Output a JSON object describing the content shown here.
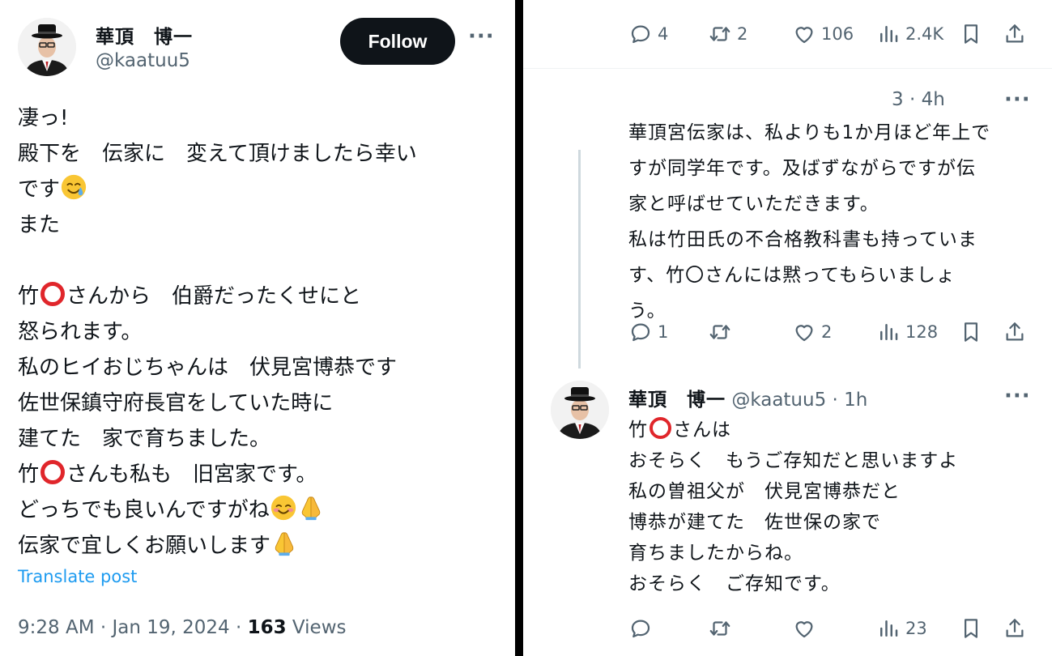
{
  "left": {
    "author_name": "華頂　博一",
    "author_handle": "@kaatuu5",
    "follow_label": "Follow",
    "more_label": "···",
    "body": {
      "l1": "凄っ!",
      "l2": "殿下を　伝家に　変えて頂けましたら幸い",
      "l3": "です",
      "l4": "また",
      "l5a": "竹",
      "l5b": "さんから　伯爵だったくせにと",
      "l6": "怒られます。",
      "l7": "私のヒイおじちゃんは　伏見宮博恭です",
      "l8": "佐世保鎮守府長官をしていた時に",
      "l9": "建てた　家で育ちました。",
      "l10a": "竹",
      "l10b": "さんも私も　旧宮家です。",
      "l11": "どっちでも良いんですがね",
      "l12": "伝家で宜しくお願いします"
    },
    "translate_label": "Translate post",
    "meta_time": "9:28 AM · Jan 19, 2024 · ",
    "meta_views_count": "163",
    "meta_views_label": " Views"
  },
  "right": {
    "top_actions": {
      "replies": "4",
      "reposts": "2",
      "likes": "106",
      "views": "2.4K"
    },
    "reply1": {
      "meta": "3 · 4h",
      "more_label": "···",
      "body": {
        "l1": "華頂宮伝家は、私よりも1か月ほど年上で",
        "l2": "すが同学年です。及ばずながらですが伝",
        "l3": "家と呼ばせていただきます。",
        "l4": "私は竹田氏の不合格教科書も持っていま",
        "l5": "す、竹〇さんには黙ってもらいましょ",
        "l6": "う。"
      },
      "actions": {
        "replies": "1",
        "reposts": "",
        "likes": "2",
        "views": "128"
      }
    },
    "reply2": {
      "author_name": "華頂　博一",
      "author_handle": "@kaatuu5",
      "time": " · 1h",
      "more_label": "···",
      "body": {
        "l1a": "竹",
        "l1b": "さんは",
        "l2": "おそらく　もうご存知だと思いますよ",
        "l3": "私の曽祖父が　伏見宮博恭だと",
        "l4": "博恭が建てた　佐世保の家で",
        "l5": "育ちましたからね。",
        "l6": "おそらく　ご存知です。"
      },
      "actions": {
        "replies": "",
        "reposts": "",
        "likes": "",
        "views": "23"
      }
    }
  },
  "colors": {
    "text": "#0f1419",
    "secondary": "#536471",
    "link": "#1d9bf0",
    "ring": "#e0262b",
    "divider": "#000000"
  },
  "icons": [
    "reply-icon",
    "repost-icon",
    "like-icon",
    "views-icon",
    "bookmark-icon",
    "share-icon",
    "more-icon",
    "tearful-smile-emoji",
    "smiling-blush-emoji",
    "folded-hands-emoji"
  ]
}
